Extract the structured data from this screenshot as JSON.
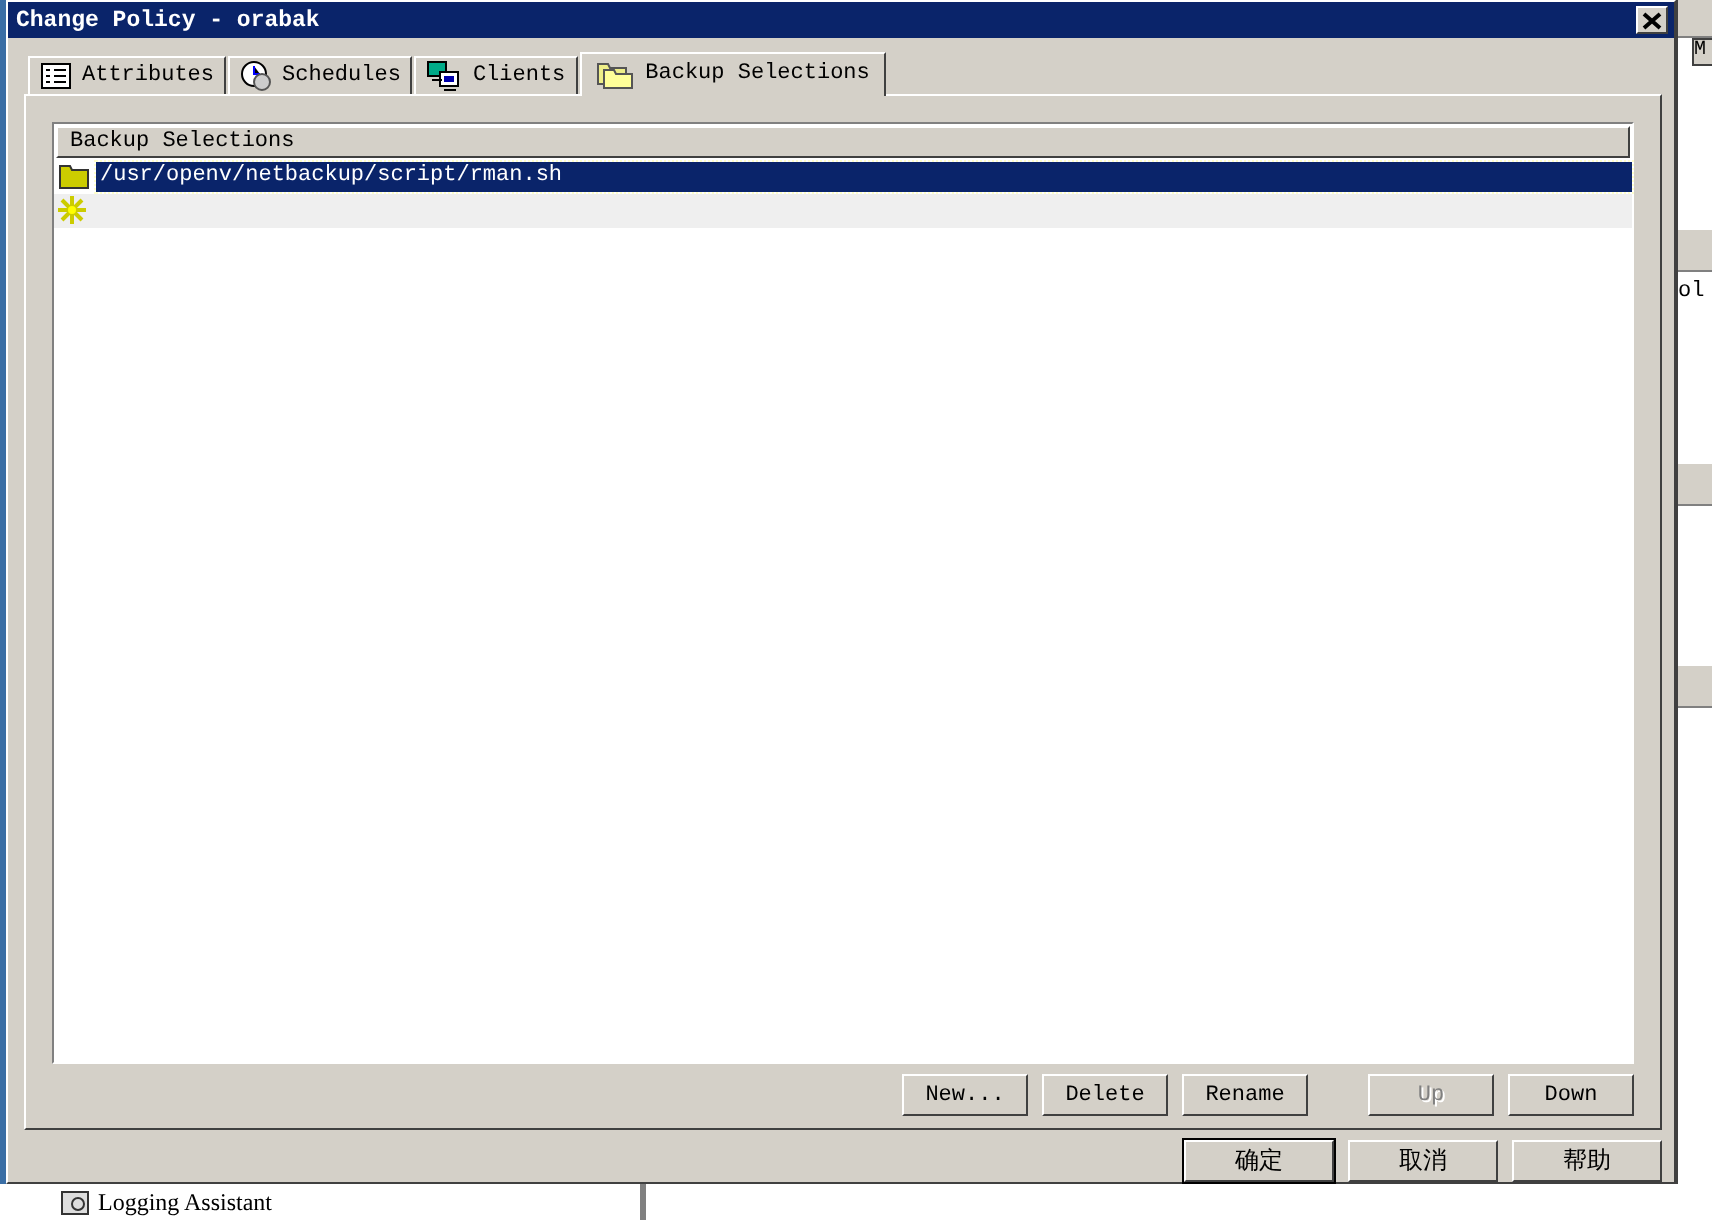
{
  "window": {
    "title": "Change Policy - orabak"
  },
  "tabs": [
    {
      "label": "Attributes",
      "selected": false
    },
    {
      "label": "Schedules",
      "selected": false
    },
    {
      "label": "Clients",
      "selected": false
    },
    {
      "label": "Backup Selections",
      "selected": true
    }
  ],
  "selections": {
    "column": "Backup Selections",
    "rows": [
      {
        "path": "/usr/openv/netbackup/script/rman.sh",
        "selected": true
      }
    ]
  },
  "list_buttons": [
    {
      "label": "New...",
      "disabled": false
    },
    {
      "label": "Delete",
      "disabled": false
    },
    {
      "label": "Rename",
      "disabled": false
    },
    {
      "label": "Up",
      "disabled": true
    },
    {
      "label": "Down",
      "disabled": false
    }
  ],
  "dialog_buttons": [
    {
      "label": "确定",
      "default": true
    },
    {
      "label": "取消",
      "default": false
    },
    {
      "label": "帮助",
      "default": false
    }
  ],
  "background": {
    "fragments": [
      "M",
      "ol"
    ],
    "tree_item": "Logging Assistant"
  }
}
